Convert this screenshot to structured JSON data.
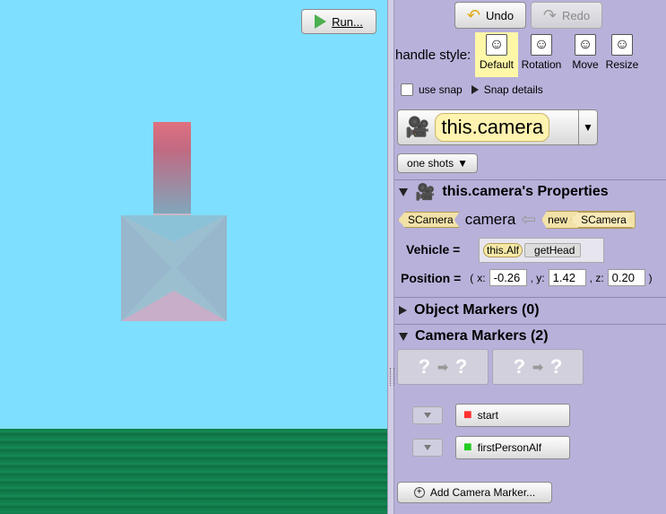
{
  "scene": {
    "run_label": "Run..."
  },
  "toolbar": {
    "undo_label": "Undo",
    "redo_label": "Redo"
  },
  "handle_style": {
    "label": "handle style:",
    "options": [
      "Default",
      "Rotation",
      "Move",
      "Resize"
    ],
    "selected": "Default"
  },
  "snap": {
    "use_snap_label": "use snap",
    "details_label": "Snap details",
    "checked": false
  },
  "camera_select": {
    "value": "this.camera"
  },
  "one_shots": {
    "label": "one shots"
  },
  "properties": {
    "header": "this.camera's Properties",
    "type_label": "SCamera",
    "name": "camera",
    "new_label": "new",
    "new_type": "SCamera",
    "vehicle_label": "Vehicle =",
    "vehicle_target": "this.Alf",
    "vehicle_method": "getHead",
    "position_label": "Position =",
    "position": {
      "open": "(",
      "x_label": "x:",
      "x": "-0.26",
      "y_label": ", y:",
      "y": "1.42",
      "z_label": ", z:",
      "z": "0.20",
      "close": ")"
    }
  },
  "object_markers": {
    "header": "Object Markers (0)"
  },
  "camera_markers": {
    "header": "Camera Markers (2)",
    "items": [
      {
        "label": "start",
        "color": "#ff3030"
      },
      {
        "label": "firstPersonAlf",
        "color": "#22cc22"
      }
    ],
    "add_label": "Add Camera Marker..."
  },
  "colors": {
    "sky": "#7fdfff",
    "ground": "#0f7a4a",
    "panel": "#b8b1da",
    "selected_handle": "#fff7a8"
  }
}
